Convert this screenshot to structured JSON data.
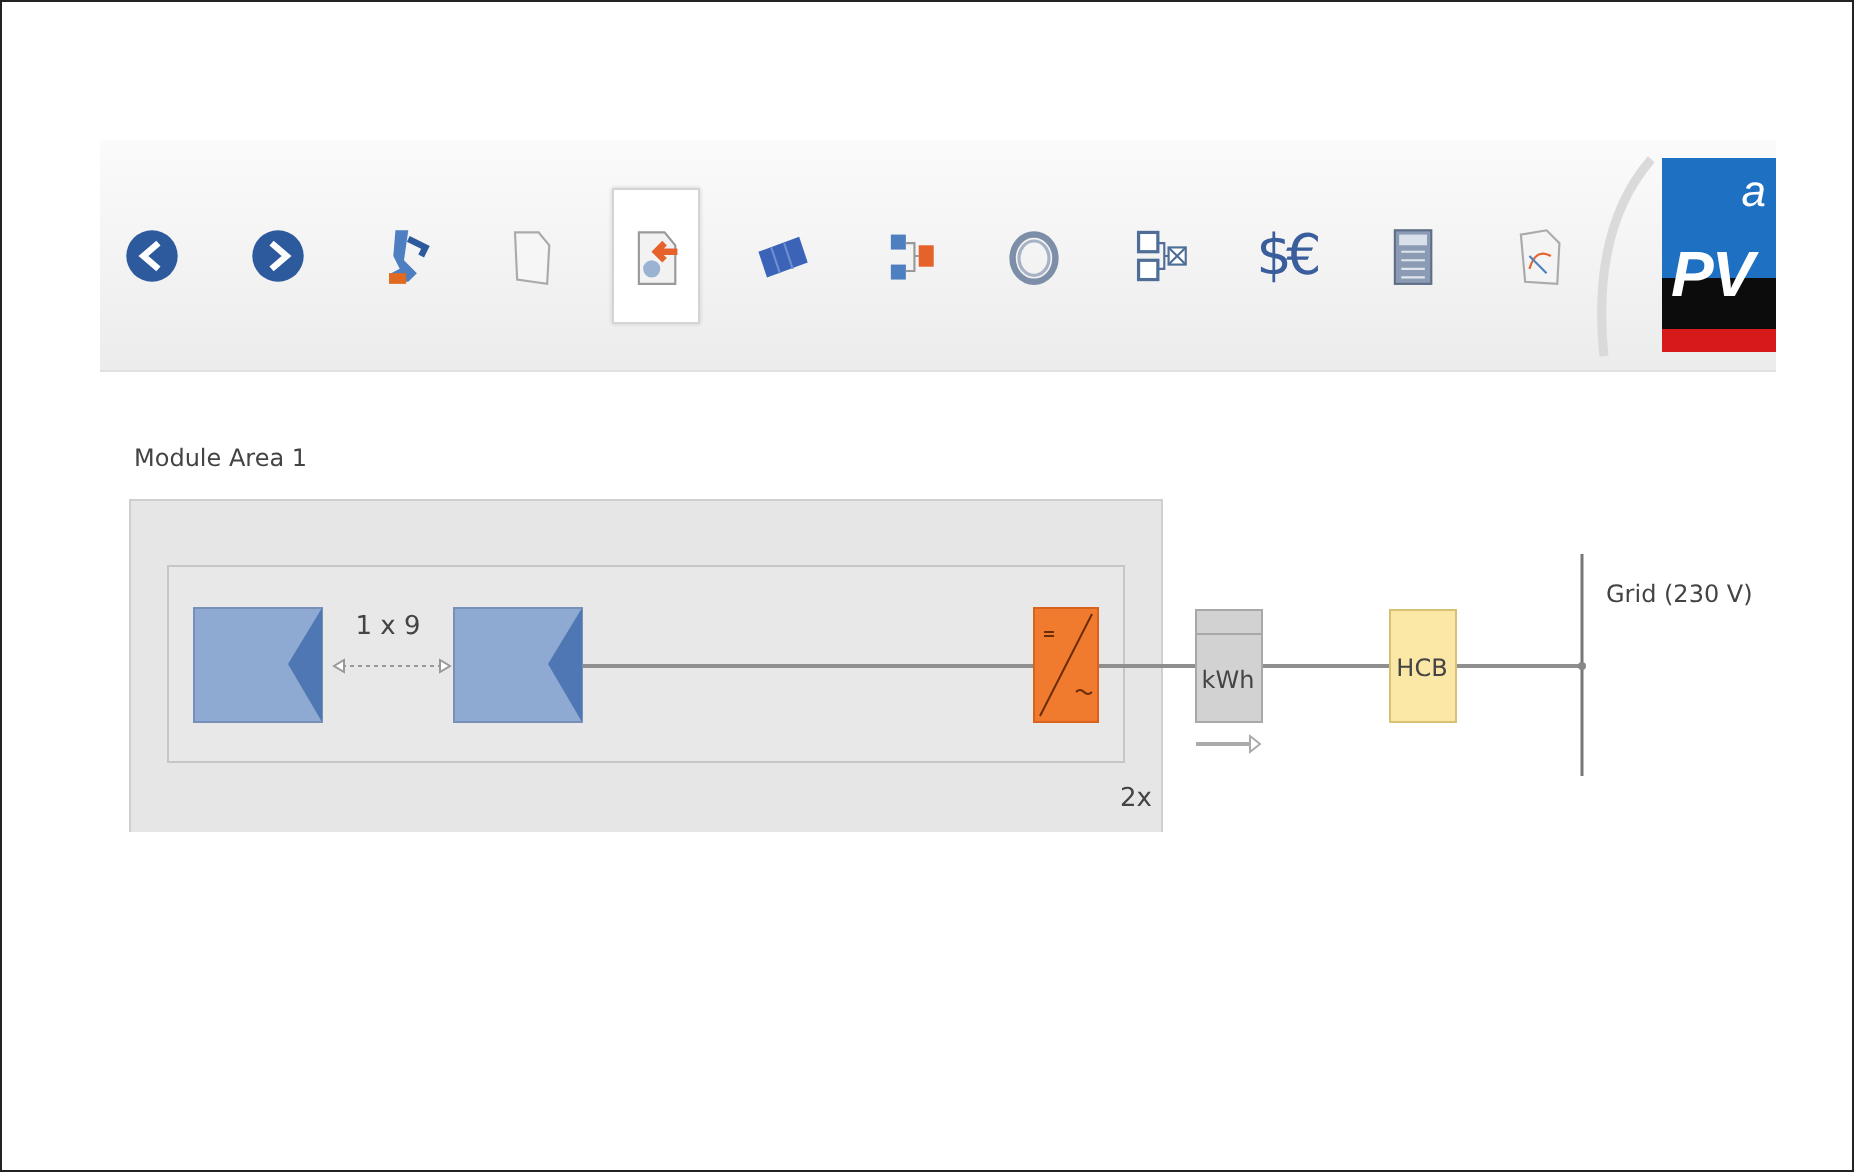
{
  "toolbar": {
    "items": [
      {
        "kind": "icon",
        "selected": false
      },
      {
        "kind": "icon",
        "selected": false
      },
      {
        "kind": "icon",
        "selected": false
      },
      {
        "kind": "icon",
        "selected": false
      },
      {
        "kind": "icon",
        "selected": true
      },
      {
        "kind": "icon",
        "selected": false
      },
      {
        "kind": "icon",
        "selected": false
      },
      {
        "kind": "icon",
        "selected": false
      },
      {
        "kind": "icon",
        "selected": false
      },
      {
        "kind": "text",
        "label": "$€",
        "selected": false
      },
      {
        "kind": "icon",
        "selected": false
      },
      {
        "kind": "icon",
        "selected": false
      }
    ],
    "logo": {
      "superscript": "a",
      "text": "PV"
    }
  },
  "diagram": {
    "area_label": "Module Area 1",
    "string_label": "1 x 9",
    "multiplier": "2x",
    "meter_label": "kWh",
    "breaker_label": "HCB",
    "grid_label": "Grid (230 V)"
  }
}
